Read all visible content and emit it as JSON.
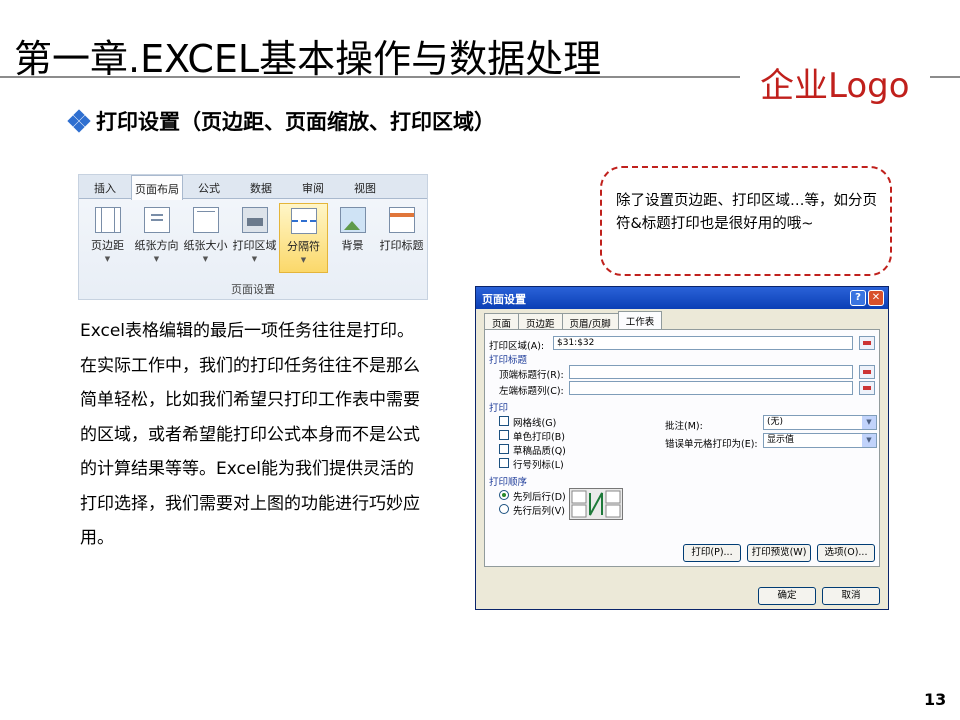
{
  "slide": {
    "title": "第一章.EXCEL基本操作与数据处理",
    "logo": "企业Logo",
    "subtitle": "打印设置（页边距、页面缩放、打印区域）",
    "page_number": "13",
    "paragraph": "Excel表格编辑的最后一项任务往往是打印。在实际工作中，我们的打印任务往往不是那么简单轻松，比如我们希望只打印工作表中需要的区域，或者希望能打印公式本身而不是公式的计算结果等等。Excel能为我们提供灵活的打印选择，我们需要对上图的功能进行巧妙应用。",
    "callout": "除了设置页边距、打印区域…等，如分页符&标题打印也是很好用的哦~"
  },
  "ribbon": {
    "tabs": [
      "插入",
      "页面布局",
      "公式",
      "数据",
      "审阅",
      "视图"
    ],
    "active_tab": "页面布局",
    "buttons": [
      "页边距",
      "纸张方向",
      "纸张大小",
      "打印区域",
      "分隔符",
      "背景",
      "打印标题"
    ],
    "highlighted_button": "分隔符",
    "group_label": "页面设置"
  },
  "dialog": {
    "title": "页面设置",
    "tabs": [
      "页面",
      "页边距",
      "页眉/页脚",
      "工作表"
    ],
    "active_tab": "工作表",
    "print_area_label": "打印区域(A):",
    "print_area_value": "$31:$32",
    "print_titles_section": "打印标题",
    "rows_repeat_label": "顶端标题行(R):",
    "cols_repeat_label": "左端标题列(C):",
    "print_section": "打印",
    "gridlines_label": "网格线(G)",
    "black_white_label": "单色打印(B)",
    "draft_label": "草稿品质(Q)",
    "row_col_headings_label": "行号列标(L)",
    "comments_label": "批注(M):",
    "comments_value": "(无)",
    "cell_errors_label": "错误单元格打印为(E):",
    "cell_errors_value": "显示值",
    "page_order_section": "打印顺序",
    "down_then_over_label": "先列后行(D)",
    "over_then_down_label": "先行后列(V)",
    "print_button": "打印(P)...",
    "preview_button": "打印预览(W)",
    "options_button": "选项(O)...",
    "ok_button": "确定",
    "cancel_button": "取消"
  },
  "colors": {
    "accent_red": "#c0201c",
    "bullet_blue": "#2f6fd0",
    "dialog_title_blue": "#0b3fb5"
  }
}
